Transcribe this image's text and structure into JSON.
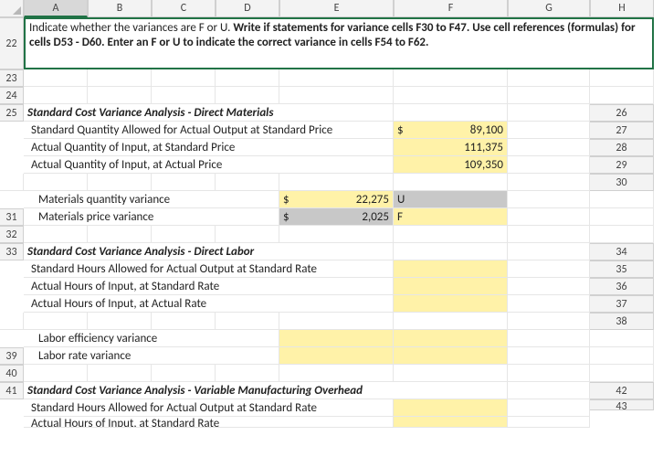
{
  "columns": [
    "A",
    "B",
    "C",
    "D",
    "E",
    "F",
    "G",
    "H"
  ],
  "rows": [
    "22",
    "23",
    "24",
    "25",
    "26",
    "27",
    "28",
    "29",
    "30",
    "31",
    "32",
    "33",
    "34",
    "35",
    "36",
    "37",
    "38",
    "39",
    "40",
    "41",
    "42",
    "43"
  ],
  "instruction": {
    "pre": "Indicate whether the variances are F or U. ",
    "bold": "Write if statements for variance cells F30 to F47. Use cell references (formulas) for cells D53 - D60. Enter an  F or U to indicate the correct variance in cells F54 to F62."
  },
  "sections": {
    "s1": "Standard Cost Variance Analysis - Direct Materials",
    "s2": "Standard Cost Variance Analysis - Direct Labor",
    "s3": "Standard Cost Variance Analysis - Variable Manufacturing Overhead"
  },
  "labels": {
    "sqasp": "Standard Quantity Allowed for Actual Output at Standard Price",
    "aqsp": "Actual Quantity of Input, at Standard Price",
    "aqap": "Actual Quantity of Input, at Actual Price",
    "mqv": "Materials quantity variance",
    "mpv": "Materials price variance",
    "shasr": "Standard Hours Allowed for Actual Output at Standard Rate",
    "ahsr": "Actual Hours of Input, at Standard Rate",
    "ahar": "Actual Hours of Input, at Actual Rate",
    "lev": "Labor efficiency variance",
    "lrv": "Labor rate variance"
  },
  "currency": "$",
  "values": {
    "g26": "89,100",
    "g27": "111,375",
    "g28": "109,350",
    "e30": "22,275",
    "e31": "2,025",
    "f30": "U",
    "f31": "F"
  },
  "chart_data": {
    "type": "table",
    "note": "Spreadsheet values visible in screenshot",
    "cells": [
      {
        "ref": "G26",
        "value": 89100,
        "format": "$#,##0",
        "highlight": "yellow"
      },
      {
        "ref": "G27",
        "value": 111375,
        "format": "#,##0",
        "highlight": "yellow"
      },
      {
        "ref": "G28",
        "value": 109350,
        "format": "#,##0",
        "highlight": "yellow"
      },
      {
        "ref": "E30",
        "value": 22275,
        "format": "$#,##0",
        "highlight": "yellow"
      },
      {
        "ref": "F30",
        "value": "U",
        "highlight": "grey"
      },
      {
        "ref": "E31",
        "value": 2025,
        "format": "$#,##0",
        "highlight": "grey"
      },
      {
        "ref": "F31",
        "value": "F",
        "highlight": "yellow"
      }
    ]
  }
}
